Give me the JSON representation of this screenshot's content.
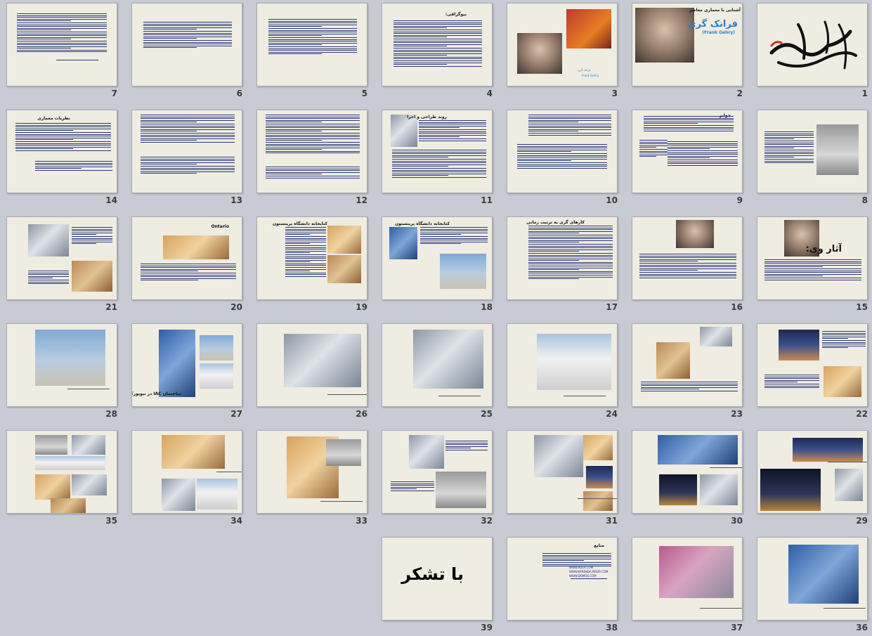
{
  "slides": [
    {
      "number": "1",
      "titles": [],
      "captions": []
    },
    {
      "number": "2",
      "titles": [
        "آشنایی با معماری معاصر",
        "فرانک گری",
        "(Frank Gehry)"
      ],
      "captions": []
    },
    {
      "number": "3",
      "titles": [],
      "captions": [
        "فرانک گری",
        "Frank Gehry"
      ]
    },
    {
      "number": "4",
      "titles": [
        "بیوگرافی:"
      ],
      "captions": []
    },
    {
      "number": "5",
      "titles": [],
      "captions": []
    },
    {
      "number": "6",
      "titles": [],
      "captions": []
    },
    {
      "number": "7",
      "titles": [],
      "captions": []
    },
    {
      "number": "8",
      "titles": [],
      "captions": []
    },
    {
      "number": "9",
      "titles": [
        "جوایز"
      ],
      "captions": []
    },
    {
      "number": "10",
      "titles": [],
      "captions": []
    },
    {
      "number": "11",
      "titles": [
        "روند طراحی و اجرا"
      ],
      "captions": []
    },
    {
      "number": "12",
      "titles": [],
      "captions": []
    },
    {
      "number": "13",
      "titles": [],
      "captions": []
    },
    {
      "number": "14",
      "titles": [
        "نظریات معماری"
      ],
      "captions": []
    },
    {
      "number": "15",
      "titles": [
        "آثار وی:"
      ],
      "captions": []
    },
    {
      "number": "16",
      "titles": [],
      "captions": []
    },
    {
      "number": "17",
      "titles": [
        "کارهای گری به ترتیب زمانی"
      ],
      "captions": []
    },
    {
      "number": "18",
      "titles": [
        "کتابخانه دانشگاه پرینستون"
      ],
      "captions": []
    },
    {
      "number": "19",
      "titles": [
        "کتابخانه دانشگاه پرینستون"
      ],
      "captions": []
    },
    {
      "number": "20",
      "titles": [
        "Ontario"
      ],
      "captions": []
    },
    {
      "number": "21",
      "titles": [],
      "captions": []
    },
    {
      "number": "22",
      "titles": [],
      "captions": []
    },
    {
      "number": "23",
      "titles": [],
      "captions": []
    },
    {
      "number": "24",
      "titles": [],
      "captions": []
    },
    {
      "number": "25",
      "titles": [],
      "captions": []
    },
    {
      "number": "26",
      "titles": [],
      "captions": []
    },
    {
      "number": "27",
      "titles": [
        "ساختمان IAC در نیویورک"
      ],
      "captions": []
    },
    {
      "number": "28",
      "titles": [],
      "captions": []
    },
    {
      "number": "29",
      "titles": [],
      "captions": []
    },
    {
      "number": "30",
      "titles": [],
      "captions": []
    },
    {
      "number": "31",
      "titles": [],
      "captions": []
    },
    {
      "number": "32",
      "titles": [],
      "captions": []
    },
    {
      "number": "33",
      "titles": [],
      "captions": []
    },
    {
      "number": "34",
      "titles": [],
      "captions": []
    },
    {
      "number": "35",
      "titles": [],
      "captions": []
    },
    {
      "number": "36",
      "titles": [],
      "captions": []
    },
    {
      "number": "37",
      "titles": [],
      "captions": []
    },
    {
      "number": "38",
      "titles": [
        "منابع"
      ],
      "captions": [
        "WWW.PDSA.COM",
        "WWW.KPRENDA.PEGIR.COM",
        "WWW.DOMOS.COM"
      ]
    },
    {
      "number": "39",
      "titles": [
        "با تشکر"
      ],
      "captions": []
    }
  ],
  "colors": {
    "background": "#c8cbd3",
    "slide": "#efece1",
    "accent_blue": "#2a7fc9",
    "text_navy": "#2a3a7a"
  }
}
